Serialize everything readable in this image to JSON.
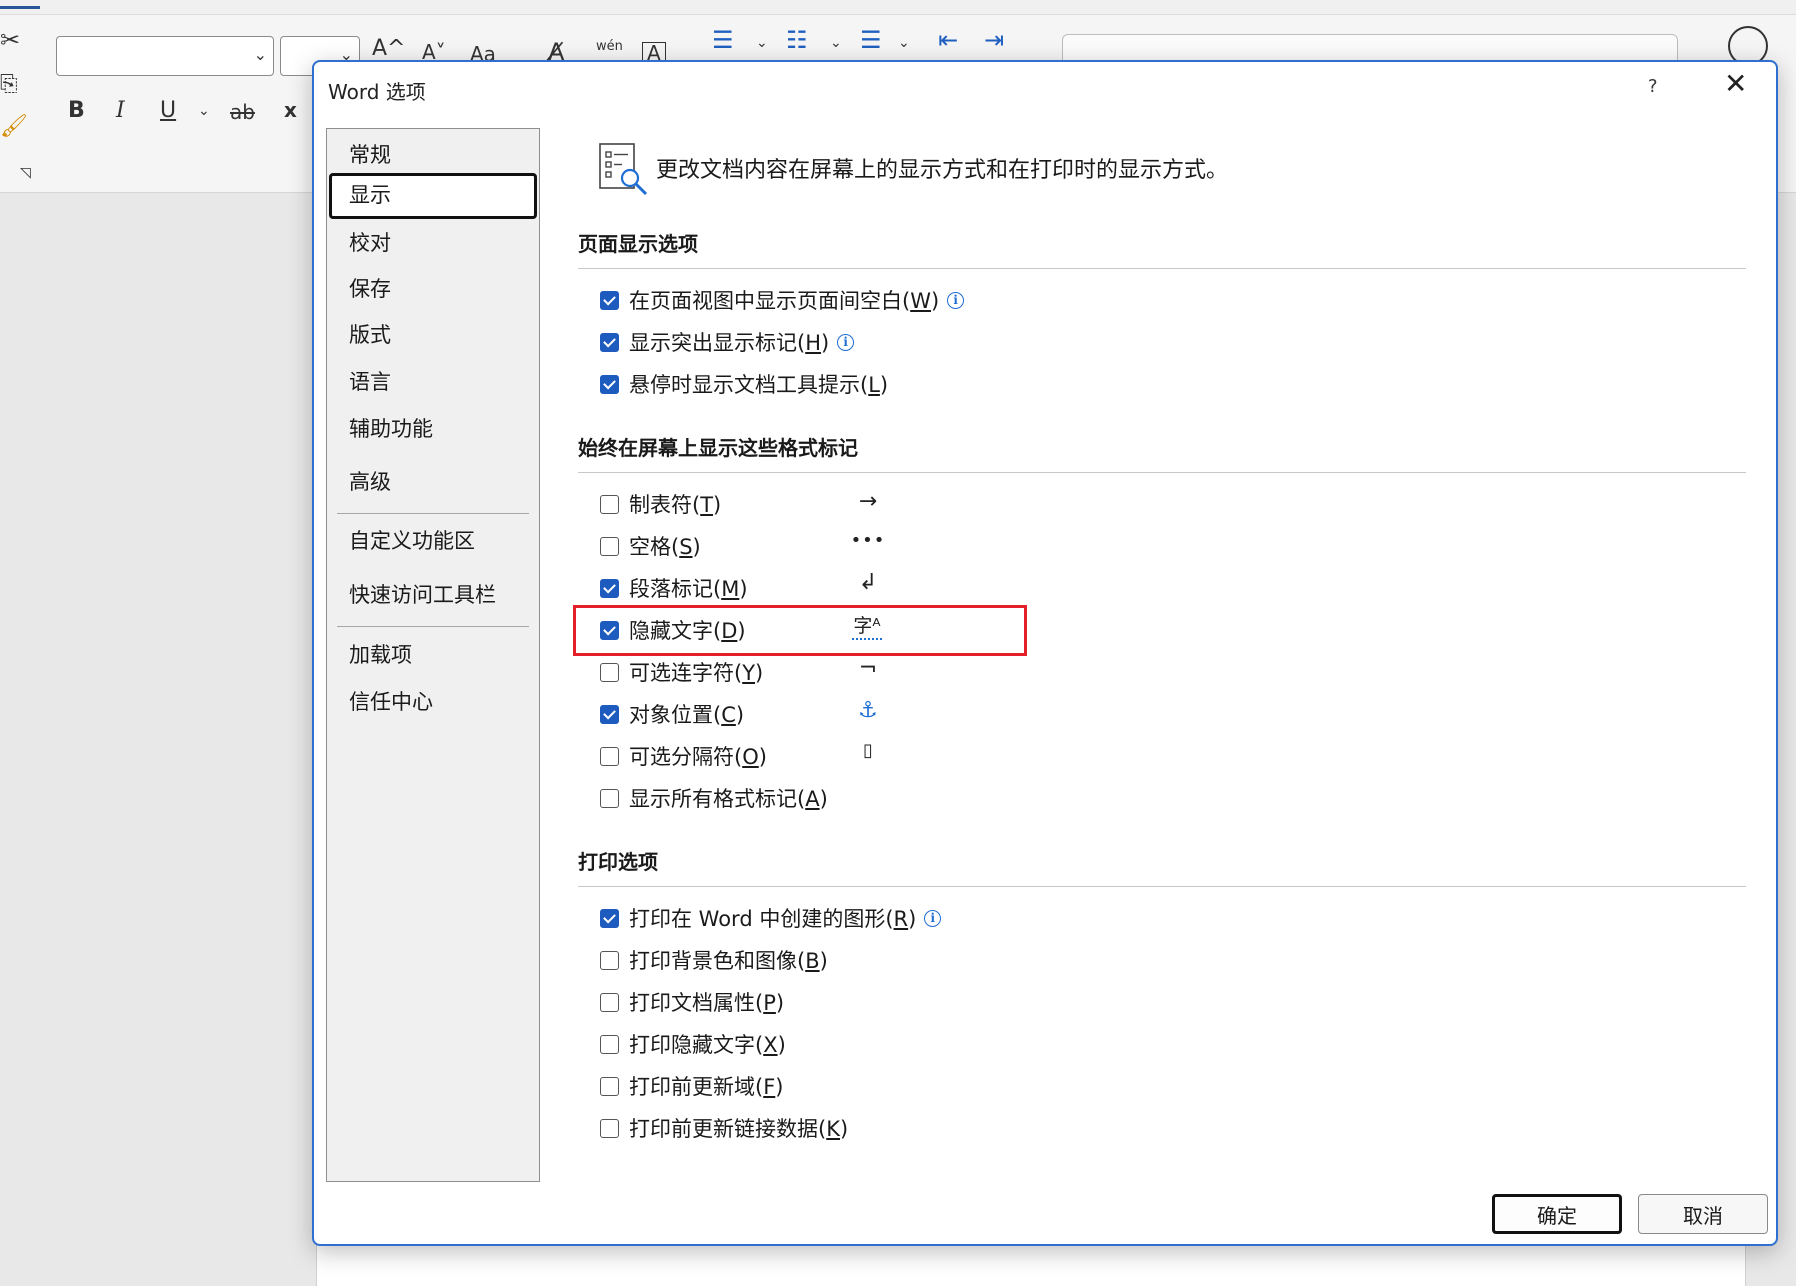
{
  "ribbon": {
    "icons": {
      "cut": "scissors-icon",
      "copy": "copy-icon",
      "format_painter": "brush-icon",
      "bold": "B",
      "italic": "I",
      "underline": "U",
      "strike": "ab",
      "subscript": "x",
      "grow_font": "A^",
      "shrink_font": "A˅",
      "change_case": "Aa",
      "phonetic": "wén",
      "char_border": "A"
    }
  },
  "dialog": {
    "title": "Word 选项",
    "help": "?",
    "close": "✕",
    "header_text": "更改文档内容在屏幕上的显示方式和在打印时的显示方式。",
    "nav": [
      {
        "label": "常规"
      },
      {
        "label": "显示"
      },
      {
        "label": "校对"
      },
      {
        "label": "保存"
      },
      {
        "label": "版式"
      },
      {
        "label": "语言"
      },
      {
        "label": "辅助功能"
      },
      {
        "label": "高级"
      },
      {
        "label": "自定义功能区"
      },
      {
        "label": "快速访问工具栏"
      },
      {
        "label": "加载项"
      },
      {
        "label": "信任中心"
      }
    ],
    "selected_nav": "显示",
    "sections": {
      "page_display": {
        "title": "页面显示选项",
        "options": [
          {
            "label": "在页面视图中显示页面间空白",
            "key": "W",
            "checked": true
          },
          {
            "label": "显示突出显示标记",
            "key": "H",
            "checked": true
          },
          {
            "label": "悬停时显示文档工具提示",
            "key": "L",
            "checked": false
          }
        ]
      },
      "format_marks": {
        "title": "始终在屏幕上显示这些格式标记",
        "options": [
          {
            "label": "制表符",
            "key": "T",
            "checked": false,
            "symbol": "→"
          },
          {
            "label": "空格",
            "key": "S",
            "checked": false,
            "symbol": "•••"
          },
          {
            "label": "段落标记",
            "key": "M",
            "checked": true,
            "symbol": "↲"
          },
          {
            "label": "隐藏文字",
            "key": "D",
            "checked": true,
            "symbol": "字ᴬ"
          },
          {
            "label": "可选连字符",
            "key": "Y",
            "checked": false,
            "symbol": "¬"
          },
          {
            "label": "对象位置",
            "key": "C",
            "checked": true,
            "symbol": "⚓"
          },
          {
            "label": "可选分隔符",
            "key": "O",
            "checked": false,
            "symbol": "▯"
          },
          {
            "label": "显示所有格式标记",
            "key": "A",
            "checked": false
          }
        ]
      },
      "print": {
        "title": "打印选项",
        "options": [
          {
            "label": "打印在 Word 中创建的图形",
            "key": "R",
            "checked": true
          },
          {
            "label": "打印背景色和图像",
            "key": "B",
            "checked": false
          },
          {
            "label": "打印文档属性",
            "key": "P",
            "checked": false
          },
          {
            "label": "打印隐藏文字",
            "key": "X",
            "checked": false
          },
          {
            "label": "打印前更新域",
            "key": "F",
            "checked": false
          },
          {
            "label": "打印前更新链接数据",
            "key": "K",
            "checked": false
          }
        ]
      }
    },
    "buttons": {
      "ok": "确定",
      "cancel": "取消"
    }
  },
  "colors": {
    "accent": "#1d5bbf",
    "dialog_border": "#2f6fcf",
    "highlight_box": "#e3202a"
  }
}
